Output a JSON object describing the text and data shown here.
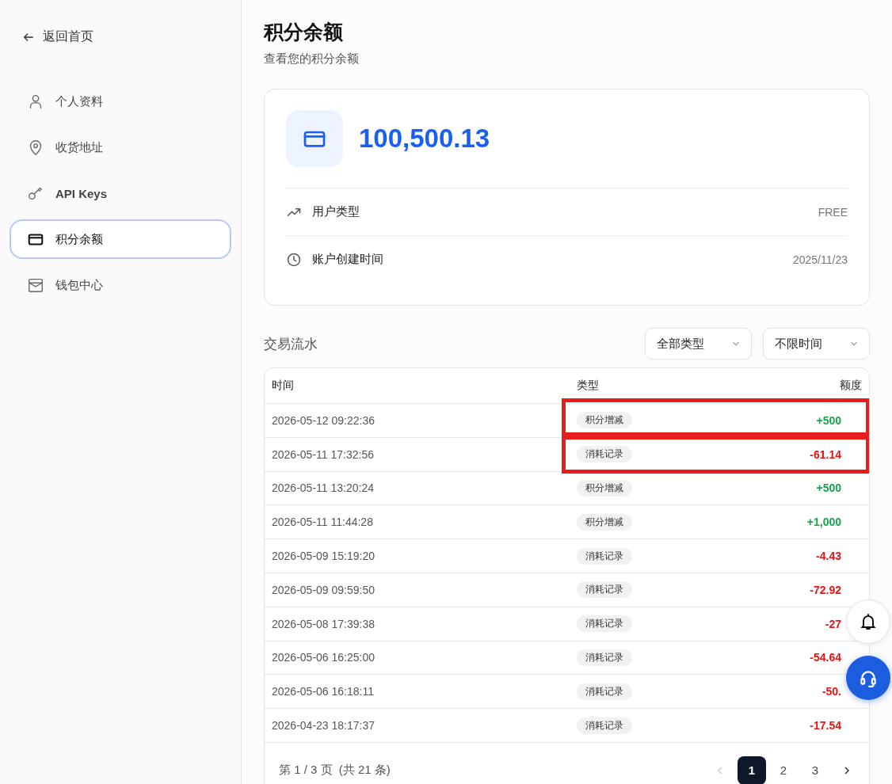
{
  "sidebar": {
    "back": "返回首页",
    "items": [
      {
        "label": "个人资料",
        "selected": false
      },
      {
        "label": "收货地址",
        "selected": false
      },
      {
        "label": "API Keys",
        "selected": false
      },
      {
        "label": "积分余额",
        "selected": true
      },
      {
        "label": "钱包中心",
        "selected": false
      }
    ]
  },
  "page": {
    "title": "积分余额",
    "subtitle": "查看您的积分余额"
  },
  "balance": {
    "amount": "100,500.13",
    "details": [
      {
        "label": "用户类型",
        "value": "FREE"
      },
      {
        "label": "账户创建时间",
        "value": "2025/11/23"
      }
    ]
  },
  "transactions": {
    "title": "交易流水",
    "filters": [
      "全部类型",
      "不限时间"
    ],
    "columns": [
      "时间",
      "类型",
      "额度"
    ],
    "rows": [
      {
        "time": "2026-05-12 09:22:36",
        "type": "积分增减",
        "amount": "+500",
        "kind": "credit",
        "highlighted": true
      },
      {
        "time": "2026-05-11 17:32:56",
        "type": "消耗记录",
        "amount": "-61.14",
        "kind": "debit",
        "highlighted": true
      },
      {
        "time": "2026-05-11 13:20:24",
        "type": "积分增减",
        "amount": "+500",
        "kind": "credit",
        "highlighted": false
      },
      {
        "time": "2026-05-11 11:44:28",
        "type": "积分增减",
        "amount": "+1,000",
        "kind": "credit",
        "highlighted": false
      },
      {
        "time": "2026-05-09 15:19:20",
        "type": "消耗记录",
        "amount": "-4.43",
        "kind": "debit",
        "highlighted": false
      },
      {
        "time": "2026-05-09 09:59:50",
        "type": "消耗记录",
        "amount": "-72.92",
        "kind": "debit",
        "highlighted": false
      },
      {
        "time": "2026-05-08 17:39:38",
        "type": "消耗记录",
        "amount": "-27",
        "kind": "debit",
        "highlighted": false
      },
      {
        "time": "2026-05-06 16:25:00",
        "type": "消耗记录",
        "amount": "-54.64",
        "kind": "debit",
        "highlighted": false
      },
      {
        "time": "2026-05-06 16:18:11",
        "type": "消耗记录",
        "amount": "-50.",
        "kind": "debit",
        "highlighted": false
      },
      {
        "time": "2026-04-23 18:17:37",
        "type": "消耗记录",
        "amount": "-17.54",
        "kind": "debit",
        "highlighted": false
      }
    ],
    "pagination": {
      "info": "第 1 / 3 页  (共 21 条)",
      "pages": [
        {
          "label": "1",
          "selected": true
        },
        {
          "label": "2",
          "selected": false
        },
        {
          "label": "3",
          "selected": false
        }
      ]
    }
  }
}
